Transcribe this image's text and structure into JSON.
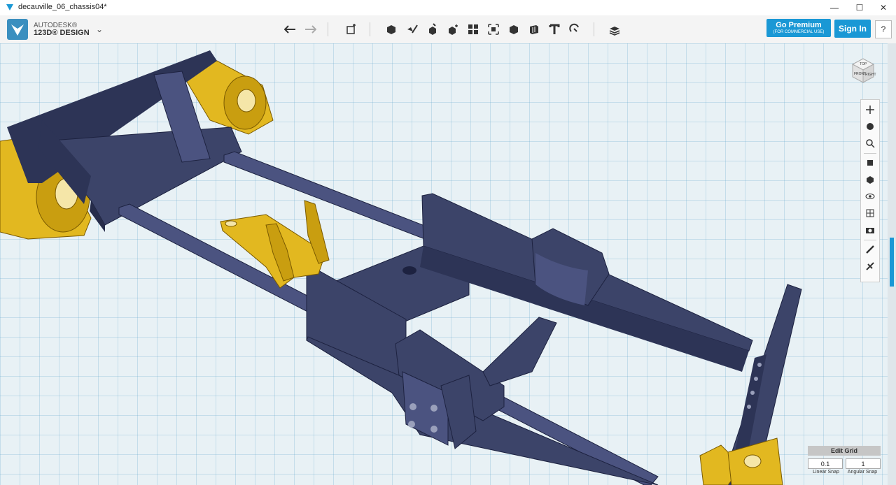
{
  "window": {
    "title": "decauville_06_chassis04*",
    "minimize": "—",
    "maximize": "☐",
    "close": "✕"
  },
  "brand": {
    "line1": "AUTODESK®",
    "line2": "123D® DESIGN",
    "menu_caret": "⌄"
  },
  "toolbar": {
    "tools": [
      "undo-icon",
      "redo-icon",
      "transform-icon",
      "primitives-icon",
      "sketch-icon",
      "construct-icon",
      "modify-icon",
      "pattern-icon",
      "grouping-icon",
      "combine-icon",
      "measure-icon",
      "text-icon",
      "snap-icon",
      "material-icon"
    ]
  },
  "premium": {
    "label": "Go Premium",
    "sub": "(FOR COMMERCIAL USE)"
  },
  "signin": {
    "label": "Sign In"
  },
  "help": {
    "label": "?"
  },
  "viewcube": {
    "top": "TOP",
    "front": "FRONT",
    "right": "RIGHT"
  },
  "nav_tools": [
    "pan-icon",
    "orbit-icon",
    "zoom-icon",
    "fit-icon",
    "view-icon",
    "visibility-icon",
    "materials-icon",
    "camera-icon",
    "brush-icon",
    "brush-alt-icon"
  ],
  "grid": {
    "title": "Edit Grid",
    "linear_value": "0.1",
    "linear_label": "Linear Snap",
    "angular_value": "1",
    "angular_label": "Angular Snap"
  },
  "colors": {
    "accent": "#1a98d5",
    "part": "#3c4469",
    "brass": "#e8c020",
    "grid_bg": "#e8f1f5"
  }
}
